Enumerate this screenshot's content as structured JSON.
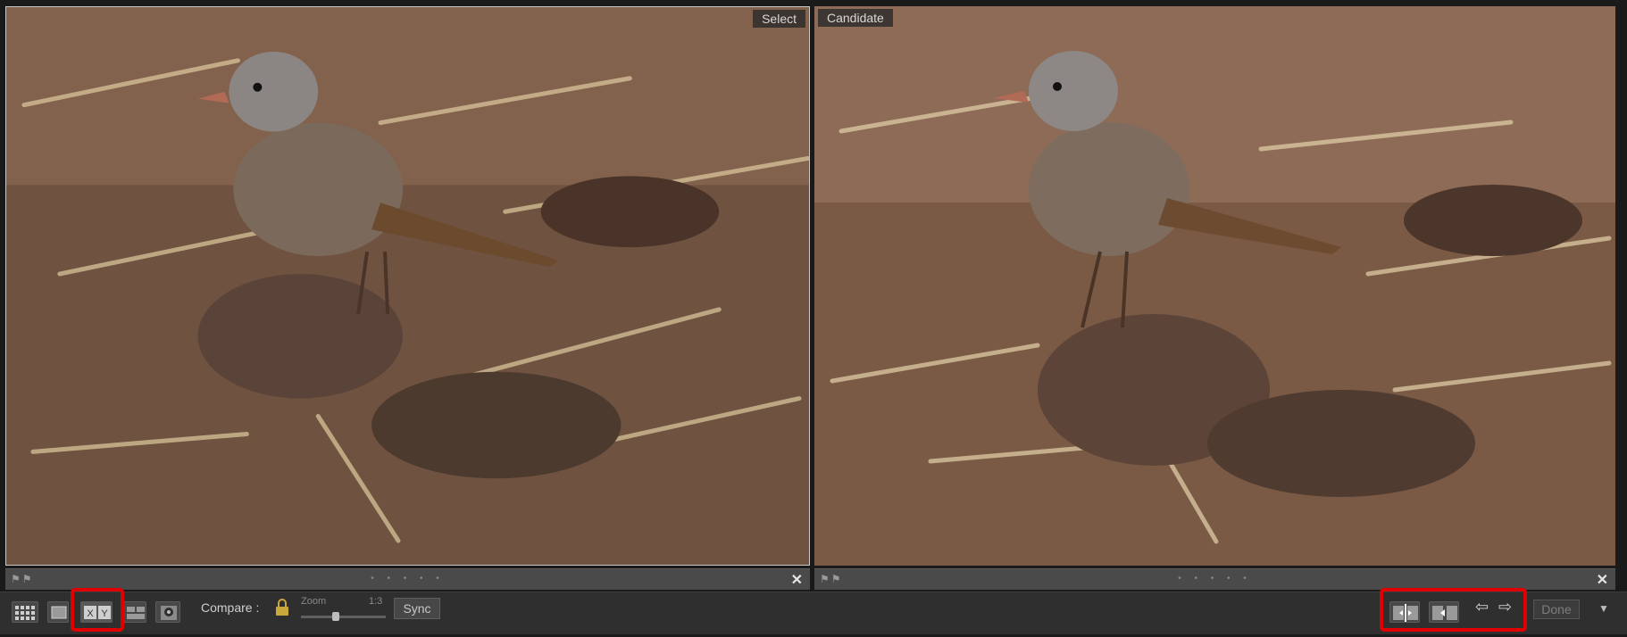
{
  "panes": {
    "left_label": "Select",
    "right_label": "Candidate"
  },
  "toolbar": {
    "compare_label": "Compare :",
    "zoom_label": "Zoom",
    "zoom_value": "1:3",
    "sync_label": "Sync",
    "done_label": "Done",
    "prev_arrow": "⇦",
    "next_arrow": "⇨",
    "menu_glyph": "▼",
    "close_glyph": "✕",
    "strip_flags": "⚑⚑",
    "strip_dots": "• • • • •"
  },
  "icons": {
    "grid": "grid-view-icon",
    "loupe": "loupe-view-icon",
    "compare": "compare-view-icon",
    "survey": "survey-view-icon",
    "people": "people-view-icon",
    "lock": "lock-icon",
    "swap": "swap-icon",
    "make_select": "make-select-icon",
    "prev": "previous-arrow-icon",
    "next": "next-arrow-icon"
  },
  "colors": {
    "highlight": "#e00000",
    "toolbar_bg": "#2f2f2f"
  }
}
